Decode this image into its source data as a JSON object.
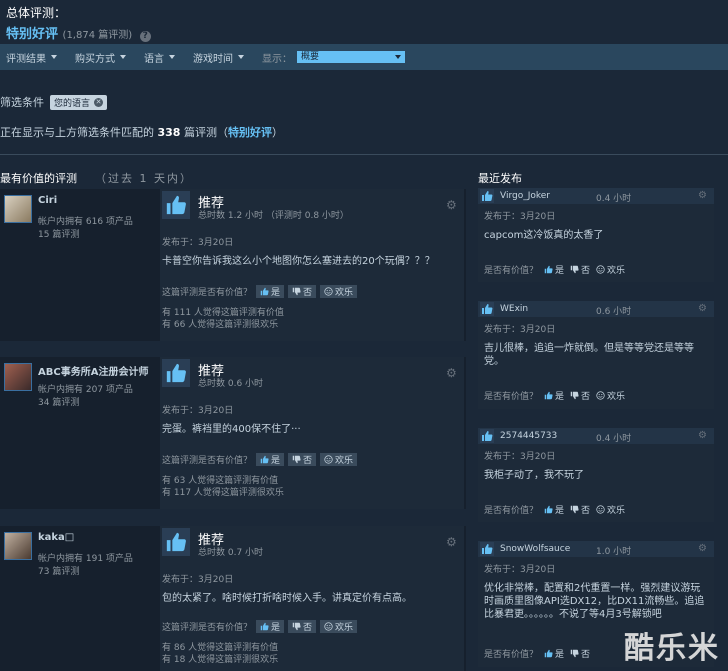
{
  "summary": {
    "label": "总体评测：",
    "score": "特别好评",
    "count": "(1,874 篇评测)"
  },
  "filters": {
    "items": [
      "评测结果",
      "购买方式",
      "语言",
      "游戏时间"
    ],
    "display_label": "显示：",
    "display_value": "概要"
  },
  "active_filters": {
    "title": "筛选条件",
    "tag": "您的语言"
  },
  "showing": {
    "prefix": "正在显示与上方筛选条件匹配的",
    "count": "338",
    "mid": "篇评测（",
    "rating": "特别好评",
    "suffix": "）"
  },
  "left_column": {
    "title": "最有价值的评测",
    "subtitle": "（过去 1 天内）"
  },
  "right_column": {
    "title": "最近发布"
  },
  "ui": {
    "recommend": "推荐",
    "helpful_q": "这篇评测是否有价值？",
    "yes": "是",
    "no": "否",
    "funny": "欢乐",
    "posted_prefix": "发布于："
  },
  "reviews": [
    {
      "name": "Ciri",
      "products": "帐户内拥有 616 项产品",
      "reviews": "15 篇评测",
      "hours": "总时数 1.2 小时 （评测时 0.8 小时）",
      "date": "3月20日",
      "text": "卡普空你告诉我这么小个地图你怎么塞进去的20个玩偶？？？",
      "helpful": "有 111 人觉得这篇评测有价值",
      "funny": "有 66 人觉得这篇评测很欢乐"
    },
    {
      "name": "ABC事务所A注册会计师",
      "products": "帐户内拥有 207 项产品",
      "reviews": "34 篇评测",
      "hours": "总时数 0.6 小时",
      "date": "3月20日",
      "text": "完蛋。裤裆里的400保不住了···",
      "helpful": "有 63 人觉得这篇评测有价值",
      "funny": "有 117 人觉得这篇评测很欢乐"
    },
    {
      "name": "kaka□",
      "products": "帐户内拥有 191 项产品",
      "reviews": "73 篇评测",
      "hours": "总时数 0.7 小时",
      "date": "3月20日",
      "text": "包的太紧了。啥时候打折啥时候入手。讲真定价有点高。",
      "helpful": "有 86 人觉得这篇评测有价值",
      "funny": "有 18 人觉得这篇评测很欢乐"
    }
  ],
  "recent": [
    {
      "name": "Virgo_Joker",
      "hours": "0.4 小时",
      "date": "3月20日",
      "text": "capcom这冷饭真的太香了",
      "helpful_q": "是否有价值？"
    },
    {
      "name": "WExin",
      "hours": "0.6 小时",
      "date": "3月20日",
      "text": "吉儿很棒，追追一炸就倒。但是等等党还是等等党。",
      "helpful_q": "是否有价值？"
    },
    {
      "name": "2574445733",
      "hours": "0.4 小时",
      "date": "3月20日",
      "text": "我柜子动了，我不玩了",
      "helpful_q": "是否有价值？"
    },
    {
      "name": "SnowWolfsauce",
      "hours": "1.0 小时",
      "date": "3月20日",
      "text": "优化非常棒，配置和2代重置一样。强烈建议游玩时画质里图像API选DX12，比DX11流畅些。追追比暴君更。。。。。。不说了等4月3号解锁吧",
      "helpful_q": "是否有价值？"
    }
  ],
  "watermark": "酷乐米",
  "colors": {
    "bg": "#1b2838",
    "accent": "#66c0f4",
    "bar": "#2a475e"
  }
}
